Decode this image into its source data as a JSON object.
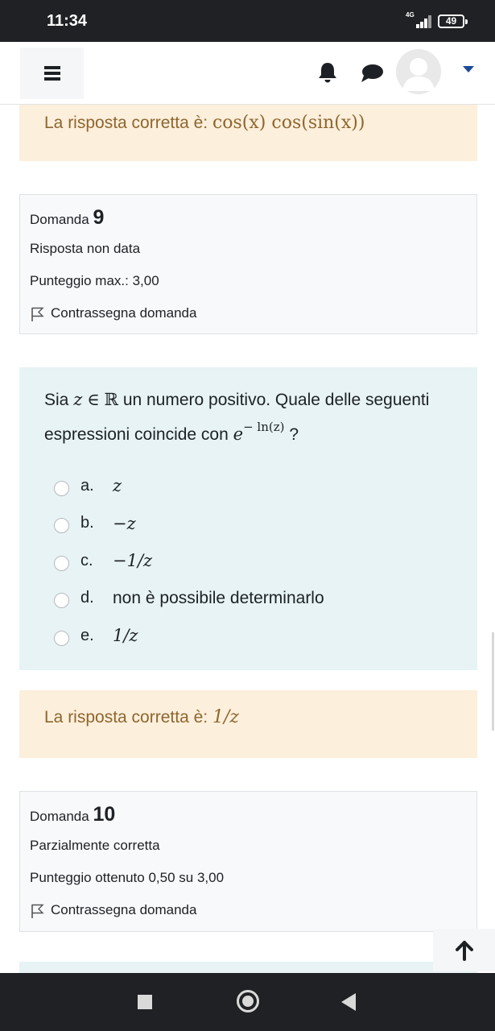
{
  "status_bar": {
    "time": "11:34",
    "network": "4G",
    "battery": "49",
    "icons": [
      "signal-icon",
      "battery-icon"
    ]
  },
  "header": {
    "icons": [
      "menu-icon",
      "bell-icon",
      "chat-icon",
      "avatar",
      "chevron-down-icon"
    ],
    "accent_color": "#1c4a9a"
  },
  "feedback_prev": {
    "label": "La risposta corretta è:",
    "math": "cos(x) cos(sin(x))"
  },
  "question9": {
    "prefix": "Domanda",
    "number": "9",
    "status": "Risposta non data",
    "score": "Punteggio max.: 3,00",
    "flag_label": "Contrassegna domanda"
  },
  "question_text": {
    "part1": "Sia",
    "var": "z",
    "in_sym": "∈",
    "reals": "ℝ",
    "part2": "un numero positivo. Quale delle seguenti espressioni coincide con",
    "base": "e",
    "exponent": "− ln(z)",
    "end": "?"
  },
  "answers": [
    {
      "letter": "a.",
      "text": "z"
    },
    {
      "letter": "b.",
      "text": "−z"
    },
    {
      "letter": "c.",
      "text": "−1/z"
    },
    {
      "letter": "d.",
      "text": "non è possibile determinarlo"
    },
    {
      "letter": "e.",
      "text": "1/z"
    }
  ],
  "feedback": {
    "label": "La risposta corretta è:",
    "math": "1/z"
  },
  "question10": {
    "prefix": "Domanda",
    "number": "10",
    "status": "Parzialmente corretta",
    "score": "Punteggio ottenuto 0,50 su 3,00",
    "flag_label": "Contrassegna domanda"
  },
  "colors": {
    "feedback_bg": "#fcefdc",
    "feedback_text": "#8e662e",
    "question_bg": "#e7f3f5",
    "info_bg": "#f8f9fa"
  }
}
